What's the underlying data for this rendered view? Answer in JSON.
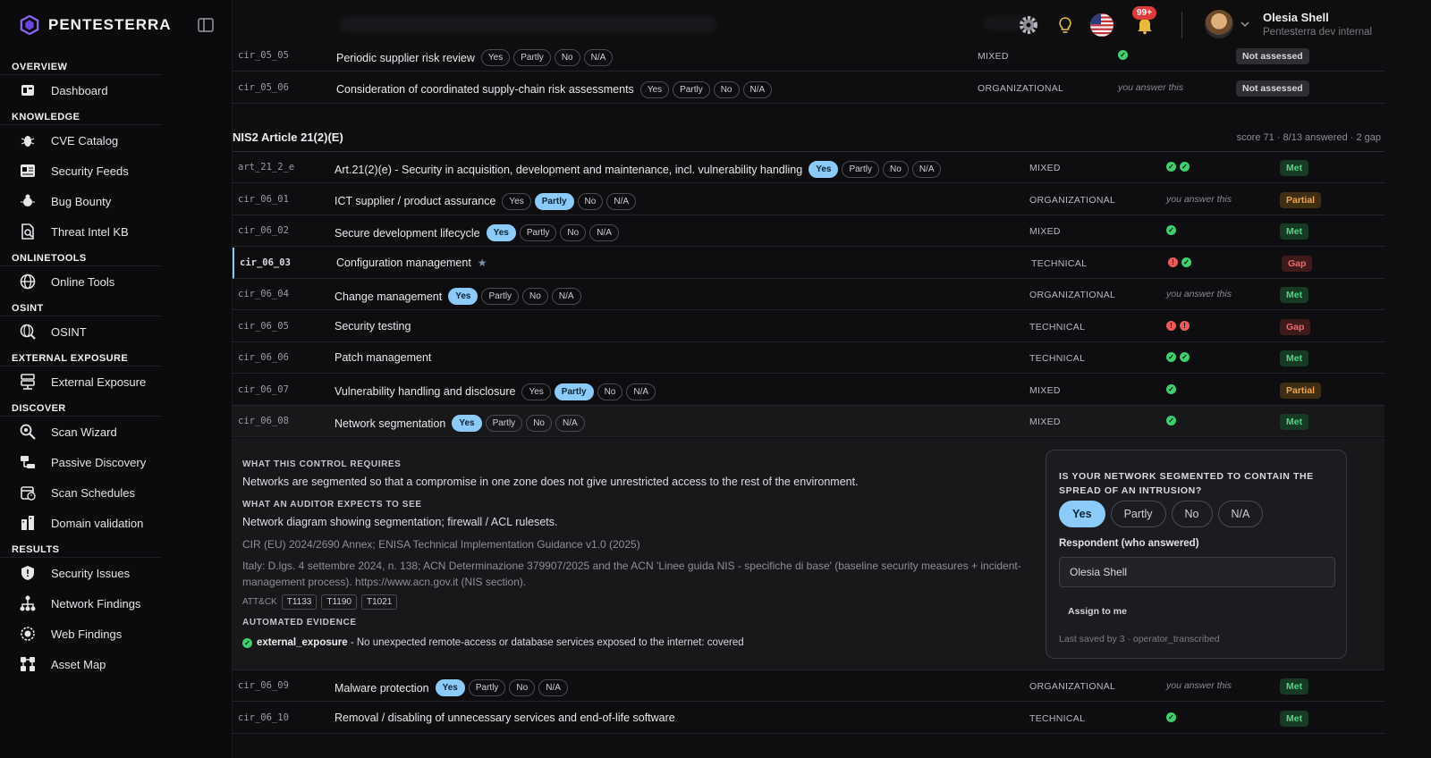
{
  "app": {
    "name": "PENTESTERRA"
  },
  "sidebar": {
    "sections": [
      {
        "label": "OVERVIEW",
        "items": [
          {
            "label": "Dashboard",
            "icon": "dashboard-icon"
          }
        ]
      },
      {
        "label": "KNOWLEDGE",
        "items": [
          {
            "label": "CVE Catalog",
            "icon": "bug-icon"
          },
          {
            "label": "Security Feeds",
            "icon": "news-icon"
          },
          {
            "label": "Bug Bounty",
            "icon": "bug-bounty-icon"
          },
          {
            "label": "Threat Intel KB",
            "icon": "document-search-icon"
          }
        ]
      },
      {
        "label": "ONLINETOOLS",
        "items": [
          {
            "label": "Online Tools",
            "icon": "globe-icon"
          }
        ]
      },
      {
        "label": "OSINT",
        "items": [
          {
            "label": "OSINT",
            "icon": "globe-search-icon"
          }
        ]
      },
      {
        "label": "EXTERNAL EXPOSURE",
        "items": [
          {
            "label": "External Exposure",
            "icon": "server-icon"
          }
        ]
      },
      {
        "label": "DISCOVER",
        "items": [
          {
            "label": "Scan Wizard",
            "icon": "scan-icon"
          },
          {
            "label": "Passive Discovery",
            "icon": "network-icon"
          },
          {
            "label": "Scan Schedules",
            "icon": "calendar-icon"
          },
          {
            "label": "Domain validation",
            "icon": "building-icon"
          }
        ]
      },
      {
        "label": "RESULTS",
        "items": [
          {
            "label": "Security Issues",
            "icon": "shield-icon"
          },
          {
            "label": "Network Findings",
            "icon": "hierarchy-icon"
          },
          {
            "label": "Web Findings",
            "icon": "web-icon"
          },
          {
            "label": "Asset Map",
            "icon": "map-icon"
          }
        ]
      }
    ]
  },
  "topbar": {
    "notifications_badge": "99+",
    "user_name": "Olesia Shell",
    "user_org": "Pentesterra dev internal"
  },
  "answers": {
    "yes": "Yes",
    "partly": "Partly",
    "no": "No",
    "na": "N/A"
  },
  "rows_top": [
    {
      "code": "cir_05_05",
      "title": "Periodic supplier risk review",
      "selected": "",
      "type": "MIXED",
      "evidence": [
        "ok"
      ],
      "answer_hint": "",
      "status": "Not assessed",
      "status_kind": "na"
    },
    {
      "code": "cir_05_06",
      "title": "Consideration of coordinated supply-chain risk assessments",
      "selected": "",
      "type": "ORGANIZATIONAL",
      "evidence": [],
      "answer_hint": "you answer this",
      "status": "Not assessed",
      "status_kind": "na"
    }
  ],
  "section": {
    "title": "NIS2 Article 21(2)(E)",
    "meta": "score 71 · 8/13 answered · 2 gap"
  },
  "rows": [
    {
      "code": "art_21_2_e",
      "title": "Art.21(2)(e) - Security in acquisition, development and maintenance, incl. vulnerability handling",
      "selected": "yes",
      "type": "MIXED",
      "evidence": [
        "ok",
        "ok"
      ],
      "answer_hint": "",
      "status": "Met",
      "status_kind": "met"
    },
    {
      "code": "cir_06_01",
      "title": "ICT supplier / product assurance",
      "selected": "partly",
      "type": "ORGANIZATIONAL",
      "evidence": [],
      "answer_hint": "you answer this",
      "status": "Partial",
      "status_kind": "partial"
    },
    {
      "code": "cir_06_02",
      "title": "Secure development lifecycle",
      "selected": "yes",
      "type": "MIXED",
      "evidence": [
        "ok"
      ],
      "answer_hint": "",
      "status": "Met",
      "status_kind": "met"
    },
    {
      "code": "cir_06_03",
      "title": "Configuration management",
      "selected": "none",
      "type": "TECHNICAL",
      "evidence": [
        "bad",
        "ok"
      ],
      "answer_hint": "",
      "status": "Gap",
      "status_kind": "gap",
      "star": true
    },
    {
      "code": "cir_06_04",
      "title": "Change management",
      "selected": "yes",
      "type": "ORGANIZATIONAL",
      "evidence": [],
      "answer_hint": "you answer this",
      "status": "Met",
      "status_kind": "met"
    },
    {
      "code": "cir_06_05",
      "title": "Security testing",
      "selected": "none",
      "type": "TECHNICAL",
      "evidence": [
        "bad",
        "bad"
      ],
      "answer_hint": "",
      "status": "Gap",
      "status_kind": "gap"
    },
    {
      "code": "cir_06_06",
      "title": "Patch management",
      "selected": "none",
      "type": "TECHNICAL",
      "evidence": [
        "ok",
        "ok"
      ],
      "answer_hint": "",
      "status": "Met",
      "status_kind": "met"
    },
    {
      "code": "cir_06_07",
      "title": "Vulnerability handling and disclosure",
      "selected": "partly",
      "type": "MIXED",
      "evidence": [
        "ok"
      ],
      "answer_hint": "",
      "status": "Partial",
      "status_kind": "partial"
    },
    {
      "code": "cir_06_08",
      "title": "Network segmentation",
      "selected": "yes",
      "type": "MIXED",
      "evidence": [
        "ok"
      ],
      "answer_hint": "",
      "status": "Met",
      "status_kind": "met"
    }
  ],
  "detail": {
    "requires_label": "WHAT THIS CONTROL REQUIRES",
    "requires_text": "Networks are segmented so that a compromise in one zone does not give unrestricted access to the rest of the environment.",
    "auditor_label": "WHAT AN AUDITOR EXPECTS TO SEE",
    "auditor_text": "Network diagram showing segmentation; firewall / ACL rulesets.",
    "ref1": "CIR (EU) 2024/2690 Annex; ENISA Technical Implementation Guidance v1.0 (2025)",
    "ref2": "Italy: D.lgs. 4 settembre 2024, n. 138; ACN Determinazione 379907/2025 and the ACN 'Linee guida NIS - specifiche di base' (baseline security measures + incident-management process). https://www.acn.gov.it (NIS section).",
    "attck_label": "ATT&CK",
    "attck": [
      "T1133",
      "T1190",
      "T1021"
    ],
    "auto_label": "AUTOMATED EVIDENCE",
    "auto_key": "external_exposure",
    "auto_text": " - No unexpected remote-access or database services exposed to the internet: covered",
    "question": "IS YOUR NETWORK SEGMENTED TO CONTAIN THE SPREAD OF AN INTRUSION?",
    "selected": "Yes",
    "respondent_label": "Respondent (who answered)",
    "respondent_value": "Olesia Shell",
    "assign_label": "Assign to me",
    "saved_text": "Last saved by 3 · operator_transcribed"
  },
  "rows_bottom": [
    {
      "code": "cir_06_09",
      "title": "Malware protection",
      "selected": "yes",
      "type": "ORGANIZATIONAL",
      "evidence": [],
      "answer_hint": "you answer this",
      "status": "Met",
      "status_kind": "met"
    },
    {
      "code": "cir_06_10",
      "title": "Removal / disabling of unnecessary services and end-of-life software",
      "selected": "none",
      "type": "TECHNICAL",
      "evidence": [
        "ok"
      ],
      "answer_hint": "",
      "status": "Met",
      "status_kind": "met"
    }
  ],
  "colors": {
    "accent": "#8ccaf7",
    "met": "#4fd683",
    "partial": "#efa54a",
    "gap": "#ef6a6a"
  }
}
